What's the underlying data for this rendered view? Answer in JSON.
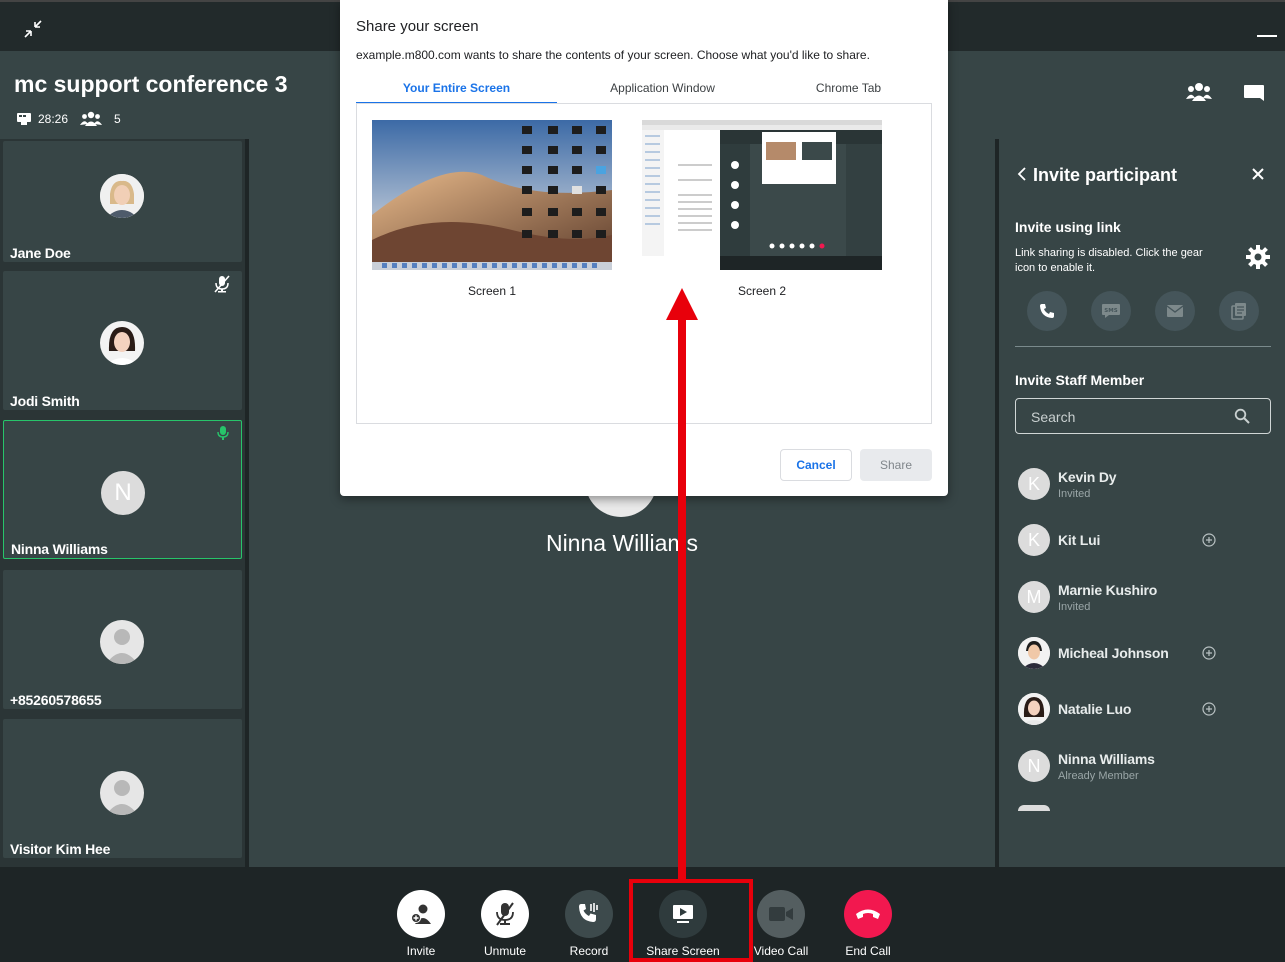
{
  "conference": {
    "title": "mc support conference 3",
    "duration": "28:26",
    "participant_count": "5"
  },
  "participants": [
    {
      "name": "Jane Doe",
      "avatar": "photo"
    },
    {
      "name": "Jodi Smith",
      "avatar": "photo",
      "mic": "muted"
    },
    {
      "name": "Ninna Williams",
      "avatar": "initial",
      "initial": "N",
      "mic": "active",
      "active": true
    },
    {
      "name": "+85260578655",
      "avatar": "generic"
    },
    {
      "name": "Visitor Kim Hee",
      "avatar": "generic"
    }
  ],
  "stage": {
    "speaker_name": "Ninna Williams"
  },
  "invite_panel": {
    "title": "Invite participant",
    "link_heading": "Invite using link",
    "link_description": "Link sharing is disabled. Click the gear icon to enable it.",
    "share_options": [
      "phone-icon",
      "sms-icon",
      "email-icon",
      "copy-icon"
    ],
    "sms_label": "SMS",
    "staff_heading": "Invite Staff Member",
    "search_placeholder": "Search",
    "staff": [
      {
        "name": "Kevin Dy",
        "status": "Invited",
        "initial": "K"
      },
      {
        "name": "Kit Lui",
        "status": "",
        "initial": "K",
        "can_add": true
      },
      {
        "name": "Marnie Kushiro",
        "status": "Invited",
        "initial": "M"
      },
      {
        "name": "Micheal Johnson",
        "status": "",
        "photo": true,
        "can_add": true
      },
      {
        "name": "Natalie Luo",
        "status": "",
        "photo": true,
        "can_add": true
      },
      {
        "name": "Ninna Williams",
        "status": "Already Member",
        "initial": "N"
      }
    ]
  },
  "controls": [
    {
      "label": "Invite",
      "icon": "add-person-icon",
      "color": "#ffffff"
    },
    {
      "label": "Unmute",
      "icon": "mic-off-icon",
      "color": "#ffffff"
    },
    {
      "label": "Record",
      "icon": "phone-record-icon",
      "color": "#3d4a4c"
    },
    {
      "label": "Share Screen",
      "icon": "screen-share-icon",
      "color": "#2f3b3d"
    },
    {
      "label": "Video Call",
      "icon": "video-icon",
      "color": "#545e60"
    },
    {
      "label": "End Call",
      "icon": "hangup-icon",
      "color": "#f2184f"
    }
  ],
  "share_dialog": {
    "title": "Share your screen",
    "subtitle": "example.m800.com wants to share the contents of your screen. Choose what you'd like to share.",
    "tabs": [
      "Your Entire Screen",
      "Application Window",
      "Chrome Tab"
    ],
    "selected_tab": "Your Entire Screen",
    "screens": [
      "Screen 1",
      "Screen 2"
    ],
    "cancel_label": "Cancel",
    "share_label": "Share"
  },
  "colors": {
    "accent_green": "#27c46a",
    "annotation_red": "#e8000b",
    "dialog_blue": "#1a73e8"
  }
}
